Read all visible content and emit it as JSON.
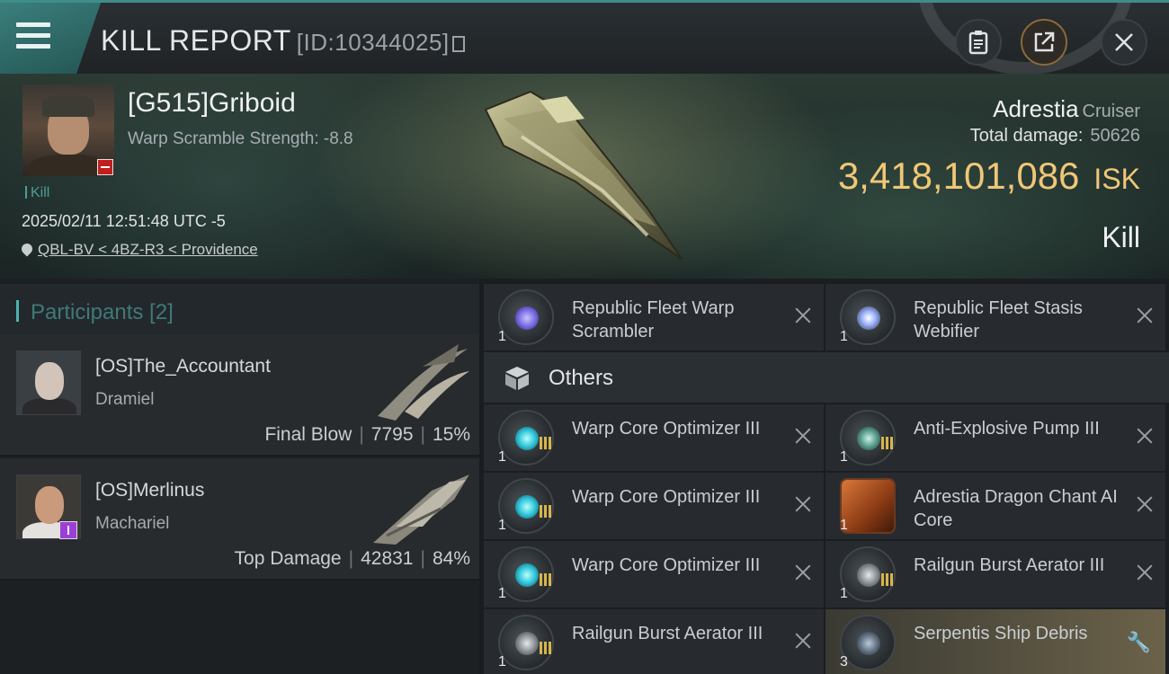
{
  "header": {
    "title": "KILL REPORT",
    "id_label": "[ID:10344025]"
  },
  "victim": {
    "name": "[G515]Griboid",
    "warp_scramble": "Warp Scramble Strength: -8.8",
    "kill_tag": "Kill",
    "datetime": "2025/02/11 12:51:48 UTC -5",
    "location": "QBL-BV < 4BZ-R3 < Providence",
    "ship_name": "Adrestia",
    "ship_class": "Cruiser",
    "total_damage_label": "Total damage:",
    "total_damage": "50626",
    "isk_value": "3,418,101,086",
    "isk_unit": "ISK",
    "result": "Kill"
  },
  "participants": {
    "title": "Participants [2]",
    "list": [
      {
        "name": "[OS]The_Accountant",
        "ship": "Dramiel",
        "role": "Final Blow",
        "damage": "7795",
        "percent": "15%"
      },
      {
        "name": "[OS]Merlinus",
        "ship": "Machariel",
        "role": "Top Damage",
        "damage": "42831",
        "percent": "84%"
      }
    ]
  },
  "modules": {
    "section_label": "Others",
    "top": [
      {
        "name": "Republic Fleet Warp Scrambler",
        "qty": "1"
      },
      {
        "name": "Republic Fleet Stasis Webifier",
        "qty": "1"
      }
    ],
    "others": [
      {
        "name": "Warp Core Optimizer III",
        "qty": "1"
      },
      {
        "name": "Anti-Explosive Pump III",
        "qty": "1"
      },
      {
        "name": "Warp Core Optimizer III",
        "qty": "1"
      },
      {
        "name": "Adrestia Dragon Chant AI Core",
        "qty": "1"
      },
      {
        "name": "Warp Core Optimizer III",
        "qty": "1"
      },
      {
        "name": "Railgun Burst Aerator III",
        "qty": "1"
      },
      {
        "name": "Railgun Burst Aerator III",
        "qty": "1"
      },
      {
        "name": "Serpentis Ship Debris",
        "qty": "3"
      }
    ]
  },
  "colors": {
    "accent_teal": "#3f8d8a",
    "isk_gold": "#f0c777",
    "tier_gold": "#d8b54a",
    "debris_highlight": "#6b6249"
  }
}
